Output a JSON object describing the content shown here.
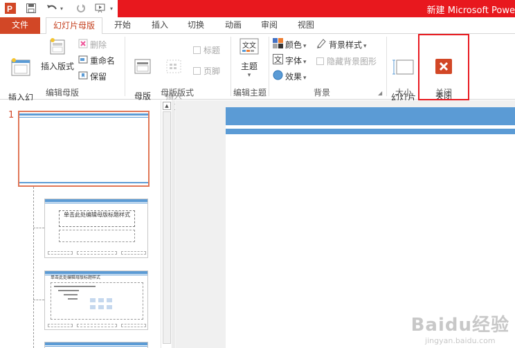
{
  "window": {
    "title": "新建 Microsoft Powe"
  },
  "tabs": [
    {
      "label": "文件"
    },
    {
      "label": "幻灯片母版"
    },
    {
      "label": "开始"
    },
    {
      "label": "插入"
    },
    {
      "label": "切换"
    },
    {
      "label": "动画"
    },
    {
      "label": "审阅"
    },
    {
      "label": "视图"
    }
  ],
  "ribbon": {
    "edit_master": {
      "group_label": "编辑母版",
      "insert_slide_master": "插入幻\n灯片母版",
      "insert_layout": "插入版式",
      "delete": "删除",
      "rename": "重命名",
      "preserve": "保留"
    },
    "master_layout": {
      "group_label": "母版版式",
      "master_layout_btn": "母版\n版式",
      "insert_placeholder": "插入\n占位符",
      "title_chk": "标题",
      "footer_chk": "页脚"
    },
    "edit_theme": {
      "group_label": "编辑主题",
      "themes_btn": "主题"
    },
    "background": {
      "group_label": "背景",
      "colors": "颜色",
      "fonts": "字体",
      "effects": "效果",
      "bg_styles": "背景样式",
      "hide_bg_graphics": "隐藏背景图形"
    },
    "size": {
      "group_label": "大小",
      "slide_size": "幻灯片\n大小"
    },
    "close": {
      "group_label": "关闭",
      "close_master_view": "关闭\n母版视图"
    }
  },
  "thumbnails": {
    "slide_number": "1",
    "layout1_title": "单击此处编辑母版标题样式",
    "layout2_title": "单击此处编辑母版标题样式"
  },
  "watermark": {
    "main": "Baidu经验",
    "sub": "jingyan.baidu.com"
  },
  "colors": {
    "title_bar": "#e8181e",
    "file_tab": "#d24726",
    "accent_blue": "#5b9bd5",
    "active_tab_text": "#c43e1c",
    "highlight": "#e8181e"
  }
}
